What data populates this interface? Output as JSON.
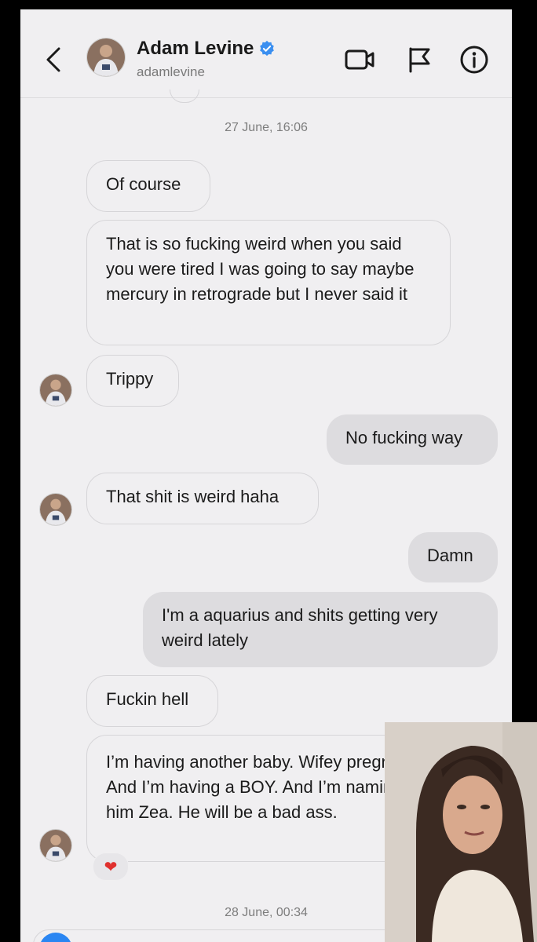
{
  "header": {
    "name": "Adam Levine",
    "handle": "adamlevine",
    "icons": [
      "back-chevron-icon",
      "video-call-icon",
      "flag-icon",
      "info-icon"
    ]
  },
  "thread": {
    "date_top": "27 June, 16:06",
    "date_bottom": "28 June, 00:34",
    "messages": [
      {
        "side": "in",
        "text": "Of course"
      },
      {
        "side": "in",
        "text": "That is so fucking weird when you said you were tired I was going to say maybe mercury in retrograde but I never said it"
      },
      {
        "side": "in",
        "text": "Trippy"
      },
      {
        "side": "out",
        "text": "No fucking way"
      },
      {
        "side": "in",
        "text": "That shit is weird haha"
      },
      {
        "side": "out",
        "text": "Damn"
      },
      {
        "side": "out",
        "text": "I'm a aquarius and shits getting very weird lately"
      },
      {
        "side": "in",
        "text": "Fuckin hell"
      },
      {
        "side": "in",
        "text": "I’m having another baby. Wifey pregnant! And I’m having a BOY. And I’m naming him Zea. He will be a bad ass."
      }
    ],
    "reaction": "❤"
  },
  "colors": {
    "background": "#f0eff1",
    "outgoing_bubble": "#dddcdf",
    "verified": "#3b8ff0",
    "compose_button": "#2a86f2"
  }
}
